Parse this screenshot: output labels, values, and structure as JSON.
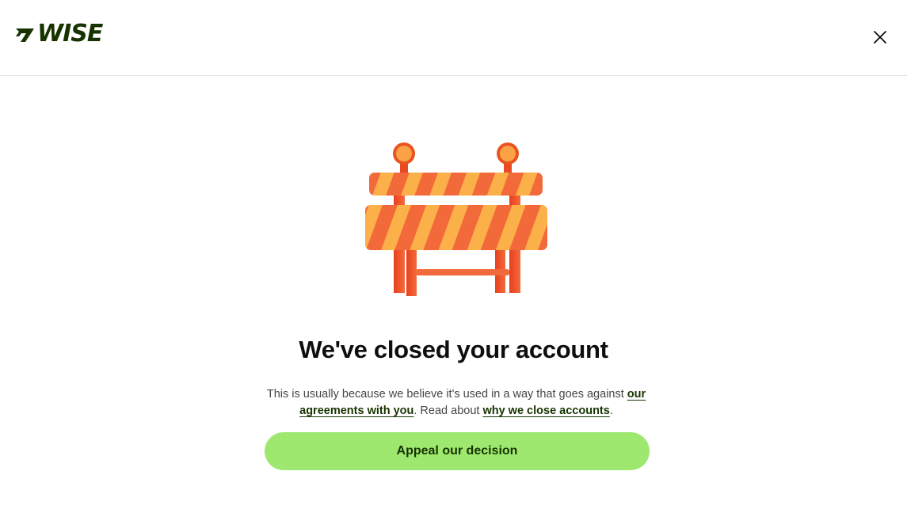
{
  "header": {
    "logo_text": "WISE",
    "close_icon": "close-icon"
  },
  "main": {
    "illustration_icon": "barrier-icon",
    "title": "We've closed your account",
    "body_part1": "This is usually because we believe it's used in a way that goes against ",
    "link_agreements": "our agreements with you",
    "body_part2": ". Read about ",
    "link_why_close": "why we close accounts",
    "body_part3": ".",
    "appeal_button": "Appeal our decision"
  },
  "colors": {
    "brand_dark": "#163300",
    "brand_green": "#9fe870",
    "text": "#0e0f0c",
    "muted_text": "#454745"
  }
}
